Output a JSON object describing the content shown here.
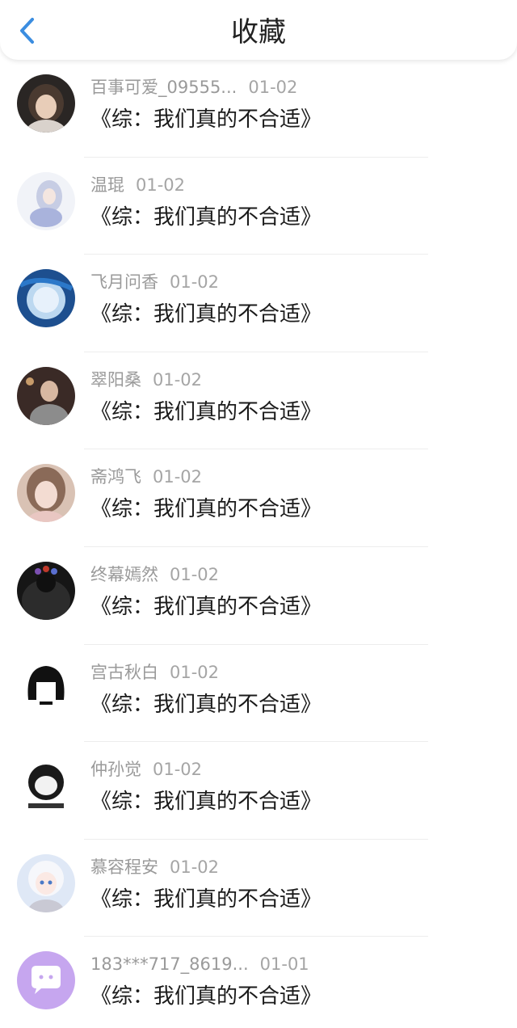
{
  "header": {
    "title": "收藏",
    "back_icon": "chevron-left-icon",
    "accent_color": "#3b8de0"
  },
  "items": [
    {
      "name": "百事可爱_09555...",
      "date": "01-02",
      "title": "《综：我们真的不合适》",
      "avatar_icon": "girl-photo-avatar"
    },
    {
      "name": "温琨",
      "date": "01-02",
      "title": "《综：我们真的不合适》",
      "avatar_icon": "anime-character-avatar"
    },
    {
      "name": "飞月问香",
      "date": "01-02",
      "title": "《综：我们真的不合适》",
      "avatar_icon": "blue-planet-avatar"
    },
    {
      "name": "翠阳桑",
      "date": "01-02",
      "title": "《综：我们真的不合适》",
      "avatar_icon": "person-photo-avatar"
    },
    {
      "name": "斋鸿飞",
      "date": "01-02",
      "title": "《综：我们真的不合适》",
      "avatar_icon": "girl-selfie-avatar"
    },
    {
      "name": "终幕嫣然",
      "date": "01-02",
      "title": "《综：我们真的不合适》",
      "avatar_icon": "dark-flower-crown-avatar"
    },
    {
      "name": "宫古秋白",
      "date": "01-02",
      "title": "《综：我们真的不合适》",
      "avatar_icon": "black-hair-sketch-avatar"
    },
    {
      "name": "仲孙觉",
      "date": "01-02",
      "title": "《综：我们真的不合适》",
      "avatar_icon": "meme-face-avatar"
    },
    {
      "name": "慕容程安",
      "date": "01-02",
      "title": "《综：我们真的不合适》",
      "avatar_icon": "white-hair-anime-avatar"
    },
    {
      "name": "183***717_8619...",
      "date": "01-01",
      "title": "《综：我们真的不合适》",
      "avatar_icon": "chat-bubble-default-avatar"
    }
  ]
}
